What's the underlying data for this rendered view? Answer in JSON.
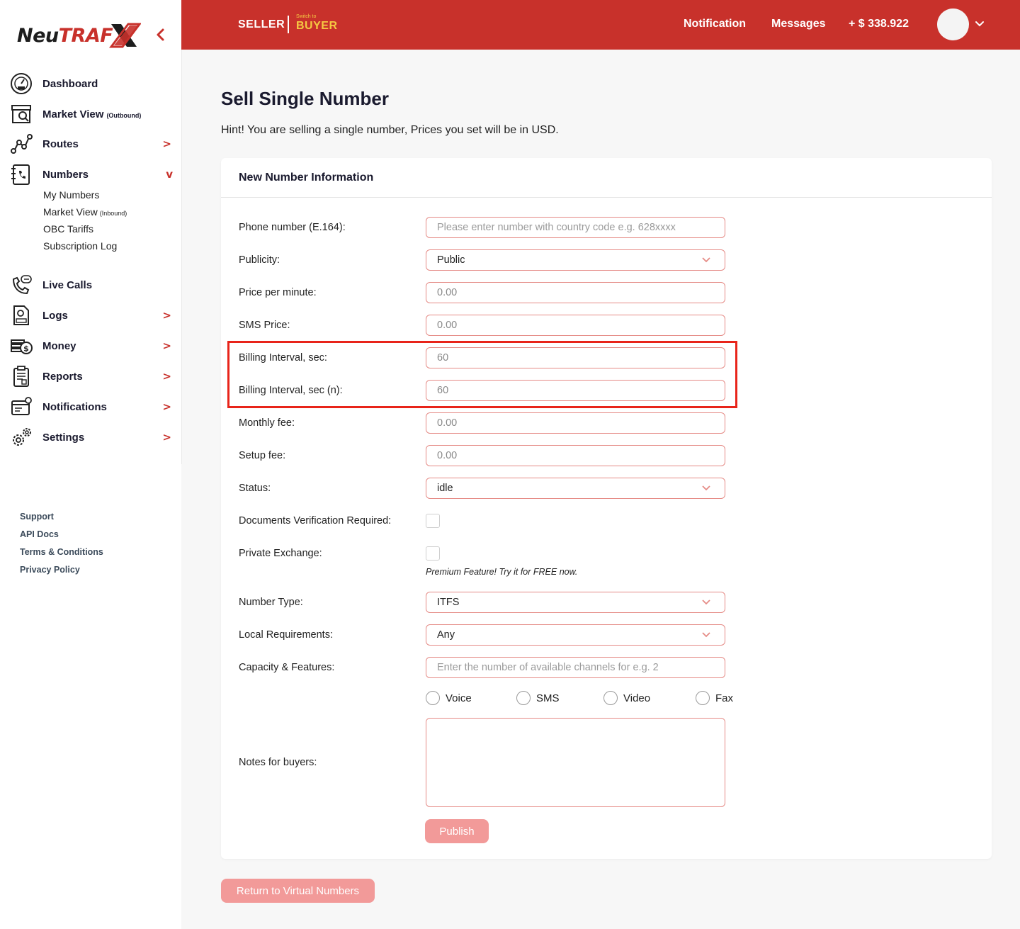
{
  "app": {
    "logo_part1": "Neu",
    "logo_part2": "TRAF",
    "brand_color": "#c8312b",
    "accent_yellow": "#f5c842"
  },
  "sidebar": {
    "nav": [
      {
        "label": "Dashboard",
        "icon": "speedometer-icon"
      },
      {
        "label": "Market View",
        "suffix": "(Outbound)",
        "icon": "storefront-icon"
      },
      {
        "label": "Routes",
        "arrow": ">",
        "icon": "route-icon"
      },
      {
        "label": "Numbers",
        "arrow": "v",
        "icon": "phonebook-icon"
      },
      {
        "label": "Live Calls",
        "icon": "phone-call-icon"
      },
      {
        "label": "Logs",
        "arrow": ">",
        "icon": "log-file-icon"
      },
      {
        "label": "Money",
        "arrow": ">",
        "icon": "money-icon"
      },
      {
        "label": "Reports",
        "arrow": ">",
        "icon": "clipboard-icon"
      },
      {
        "label": "Notifications",
        "arrow": ">",
        "icon": "notification-icon"
      },
      {
        "label": "Settings",
        "arrow": ">",
        "icon": "gears-icon"
      }
    ],
    "numbers_sub": [
      {
        "label": "My Numbers"
      },
      {
        "label": "Market View",
        "suffix": "(Inbound)"
      },
      {
        "label": "OBC Tariffs"
      },
      {
        "label": "Subscription Log"
      }
    ],
    "footer": [
      "Support",
      "API Docs",
      "Terms & Conditions",
      "Privacy Policy"
    ]
  },
  "header": {
    "role": "SELLER",
    "switch_hint": "Switch to",
    "switch_target": "BUYER",
    "notification": "Notification",
    "messages": "Messages",
    "balance": "+ $ 338.922"
  },
  "main": {
    "title": "Sell Single Number",
    "hint": "Hint! You are selling a single number, Prices you set will be in USD.",
    "card_title": "New Number Information",
    "form": {
      "phone_label": "Phone number (E.164):",
      "phone_placeholder": "Please enter number with country code e.g. 628xxxx",
      "publicity_label": "Publicity:",
      "publicity_value": "Public",
      "ppm_label": "Price per minute:",
      "ppm_value": "0.00",
      "sms_label": "SMS Price:",
      "sms_value": "0.00",
      "billing_label": "Billing Interval, sec:",
      "billing_value": "60",
      "billing_n_label": "Billing Interval, sec (n):",
      "billing_n_value": "60",
      "monthly_label": "Monthly fee:",
      "monthly_value": "0.00",
      "setup_label": "Setup fee:",
      "setup_value": "0.00",
      "status_label": "Status:",
      "status_value": "idle",
      "docs_label": "Documents Verification Required:",
      "docs_checked": false,
      "private_label": "Private Exchange:",
      "private_checked": false,
      "premium_note": "Premium Feature! Try it for FREE now.",
      "number_type_label": "Number Type:",
      "number_type_value": "ITFS",
      "local_req_label": "Local Requirements:",
      "local_req_value": "Any",
      "capacity_label": "Capacity & Features:",
      "capacity_placeholder": "Enter the number of available channels for e.g. 2",
      "features": [
        "Voice",
        "SMS",
        "Video",
        "Fax"
      ],
      "notes_label": "Notes for buyers:",
      "notes_value": "",
      "publish_label": "Publish"
    },
    "return_label": "Return to Virtual Numbers"
  }
}
